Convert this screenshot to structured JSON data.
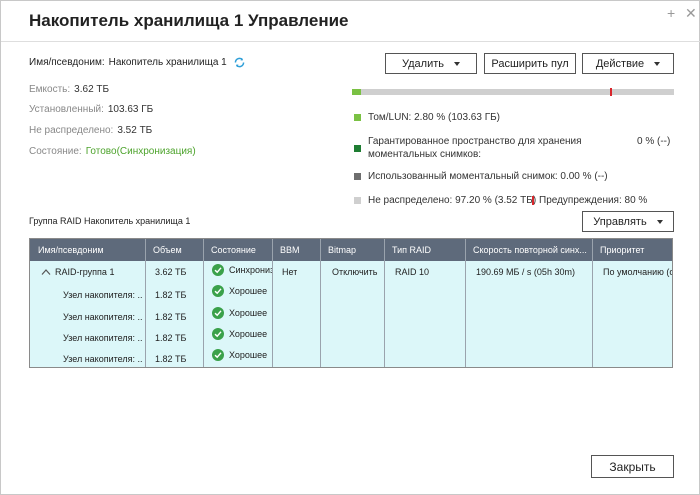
{
  "window": {
    "title": "Накопитель хранилища 1 Управление",
    "plus_glyph": "+",
    "close_glyph": "✕"
  },
  "info": {
    "alias_label": "Имя/псевдоним:",
    "alias_value": "Накопитель хранилища 1",
    "capacity_label": "Емкость:",
    "capacity_value": "3.62 ТБ",
    "installed_label": "Установленный:",
    "installed_value": "103.63 ГБ",
    "unallocated_label": "Не распределено:",
    "unallocated_value": "3.52 ТБ",
    "status_label": "Состояние:",
    "status_value": "Готово(Синхронизация)"
  },
  "toolbar": {
    "delete_label": "Удалить",
    "expand_label": "Расширить пул",
    "action_label": "Действие"
  },
  "usage": {
    "used_fraction": 0.028,
    "warning_fraction": 0.8,
    "tlun_text": "Том/LUN: 2.80 % (103.63 ГБ)",
    "guaranteed_text": "Гарантированное пространство для хранения моментальных снимков:",
    "guaranteed_pct": "0 % (--)",
    "snapshot_used_text": "Использованный моментальный снимок: 0.00 % (--)",
    "unallocated_text": "Не распределено: 97.20 % (3.52 ТБ)",
    "warning_text": "Предупреждения: 80 %"
  },
  "colors": {
    "tlun": "#7ac143",
    "guaranteed": "#1e7d32",
    "snapshot_used": "#6e6e6e",
    "unallocated": "#cfcfcf",
    "warning": "#d9262c"
  },
  "raid": {
    "group_label": "Группа RAID Накопитель хранилища 1",
    "manage_label": "Управлять",
    "headers": [
      "Имя/псевдоним",
      "Объем",
      "Состояние",
      "BBM",
      "Bitmap",
      "Тип RAID",
      "Скорость повторной синх...",
      "Приоритет"
    ],
    "group_row": {
      "name": "RAID-группа 1",
      "size": "3.62 ТБ",
      "status": "Синхронизация",
      "bbm": "Нет",
      "bitmap": "Отключить",
      "raid_type": "RAID 10",
      "speed": "190.69 МБ / s (05h 30m)",
      "priority": "По умолчанию (среднее)"
    },
    "disks": [
      {
        "name": "Узел накопителя: ...",
        "size": "1.82 ТБ",
        "status": "Хорошее"
      },
      {
        "name": "Узел накопителя: ...",
        "size": "1.82 ТБ",
        "status": "Хорошее"
      },
      {
        "name": "Узел накопителя: ...",
        "size": "1.82 ТБ",
        "status": "Хорошее"
      },
      {
        "name": "Узел накопителя: ...",
        "size": "1.82 ТБ",
        "status": "Хорошее"
      }
    ]
  },
  "footer": {
    "close_label": "Закрыть"
  }
}
